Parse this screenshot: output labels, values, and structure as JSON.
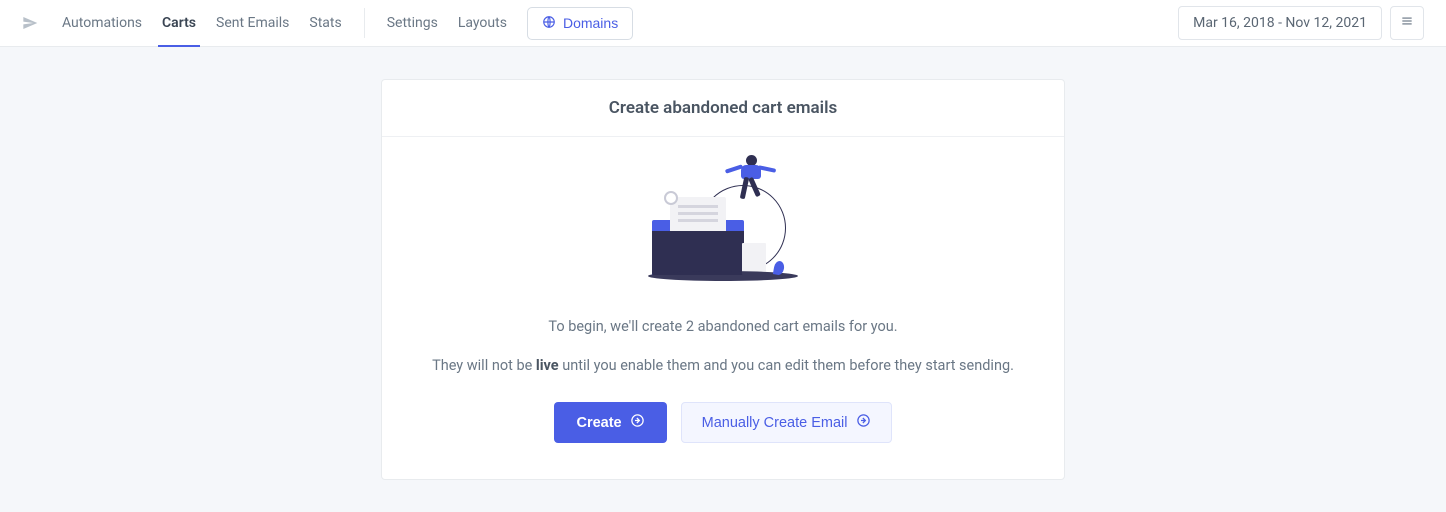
{
  "nav": {
    "automations": "Automations",
    "carts": "Carts",
    "sent_emails": "Sent Emails",
    "stats": "Stats",
    "settings": "Settings",
    "layouts": "Layouts",
    "domains": "Domains"
  },
  "header": {
    "date_range": "Mar 16, 2018 - Nov 12, 2021"
  },
  "card": {
    "title": "Create abandoned cart emails",
    "desc1": "To begin, we'll create 2 abandoned cart emails for you.",
    "desc2_pre": "They will not be ",
    "desc2_bold": "live",
    "desc2_post": " until you enable them and you can edit them before they start sending.",
    "create_btn": "Create",
    "manual_btn": "Manually Create Email"
  }
}
